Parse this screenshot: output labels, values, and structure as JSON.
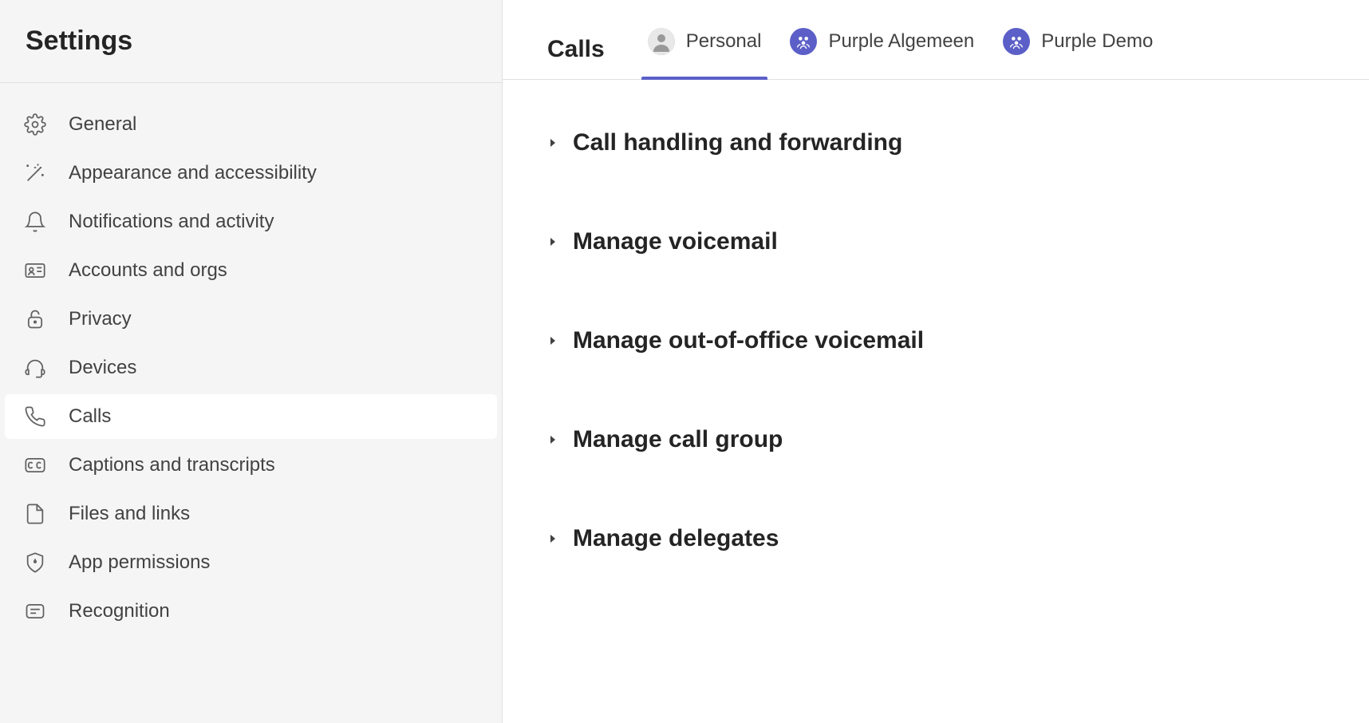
{
  "sidebar": {
    "title": "Settings",
    "items": [
      {
        "icon": "gear-icon",
        "label": "General"
      },
      {
        "icon": "wand-icon",
        "label": "Appearance and accessibility"
      },
      {
        "icon": "bell-icon",
        "label": "Notifications and activity"
      },
      {
        "icon": "id-card-icon",
        "label": "Accounts and orgs"
      },
      {
        "icon": "lock-icon",
        "label": "Privacy"
      },
      {
        "icon": "headset-icon",
        "label": "Devices"
      },
      {
        "icon": "phone-icon",
        "label": "Calls",
        "active": true
      },
      {
        "icon": "cc-icon",
        "label": "Captions and transcripts"
      },
      {
        "icon": "file-icon",
        "label": "Files and links"
      },
      {
        "icon": "shield-icon",
        "label": "App permissions"
      },
      {
        "icon": "text-icon",
        "label": "Recognition"
      }
    ]
  },
  "main": {
    "title": "Calls",
    "tabs": [
      {
        "type": "avatar",
        "label": "Personal",
        "active": true
      },
      {
        "type": "team",
        "label": "Purple Algemeen"
      },
      {
        "type": "team",
        "label": "Purple Demo"
      }
    ],
    "sections": [
      {
        "label": "Call handling and forwarding"
      },
      {
        "label": "Manage voicemail"
      },
      {
        "label": "Manage out-of-office voicemail"
      },
      {
        "label": "Manage call group"
      },
      {
        "label": "Manage delegates"
      }
    ]
  }
}
